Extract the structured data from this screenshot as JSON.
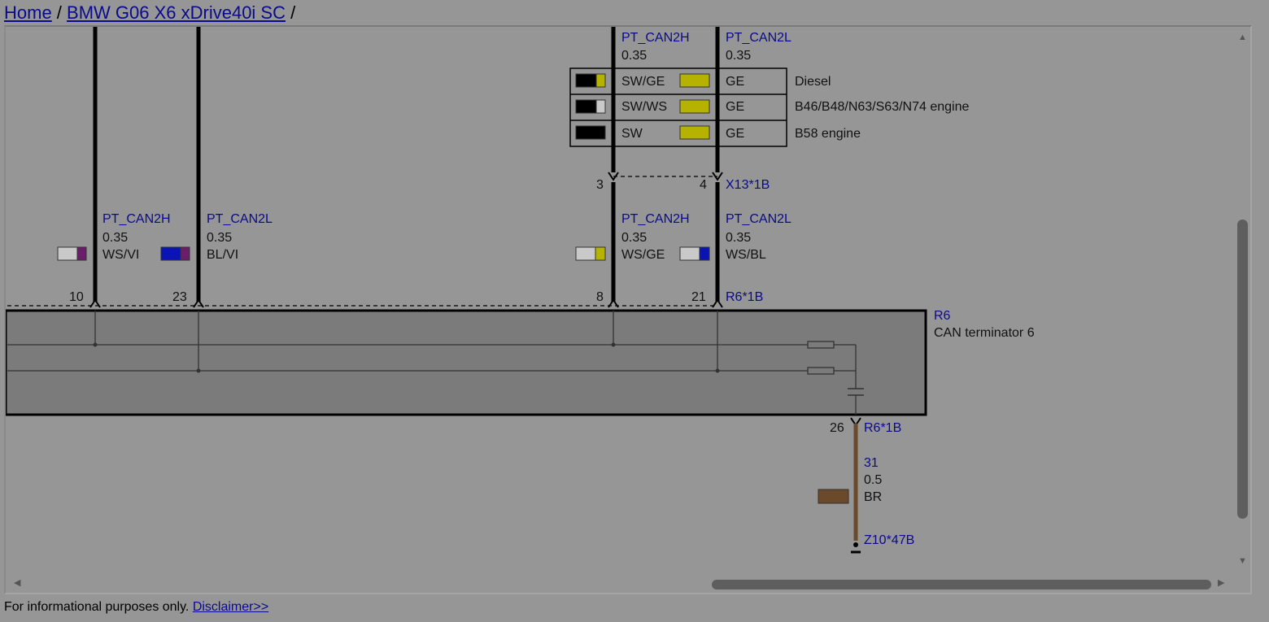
{
  "breadcrumb": {
    "home": "Home",
    "sep1": " / ",
    "vehicle": "BMW G06 X6 xDrive40i SC",
    "sep2": " /"
  },
  "footer": {
    "text": "For informational purposes only. ",
    "link": "Disclaimer>>"
  },
  "scroll": {
    "up_arrow": "▲",
    "down_arrow": "▼",
    "left_arrow": "◀",
    "right_arrow": "▶"
  },
  "wires": {
    "x13_h": {
      "signal": "PT_CAN2H",
      "gauge": "0.35"
    },
    "x13_l": {
      "signal": "PT_CAN2L",
      "gauge": "0.35"
    },
    "left_h": {
      "signal": "PT_CAN2H",
      "gauge": "0.35",
      "color": "WS/VI"
    },
    "left_l": {
      "signal": "PT_CAN2L",
      "gauge": "0.35",
      "color": "BL/VI"
    },
    "r6_h": {
      "signal": "PT_CAN2H",
      "gauge": "0.35",
      "color": "WS/GE"
    },
    "r6_l": {
      "signal": "PT_CAN2L",
      "gauge": "0.35",
      "color": "WS/BL"
    },
    "ground": {
      "signal": "31",
      "gauge": "0.5",
      "color": "BR"
    }
  },
  "variants": [
    {
      "h_color": "SW/GE",
      "l_color": "GE",
      "note": "Diesel"
    },
    {
      "h_color": "SW/WS",
      "l_color": "GE",
      "note": "B46/B48/N63/S63/N74 engine"
    },
    {
      "h_color": "SW",
      "l_color": "GE",
      "note": "B58 engine"
    }
  ],
  "connectors": {
    "x13": {
      "name": "X13*1B",
      "pin_h": "3",
      "pin_l": "4"
    },
    "r6_top": {
      "name": "R6*1B",
      "pins": [
        "10",
        "23",
        "8",
        "21"
      ]
    },
    "r6_bottom": {
      "name": "R6*1B",
      "pin": "26"
    },
    "ground_point": {
      "name": "Z10*47B"
    }
  },
  "component": {
    "id": "R6",
    "name": "CAN terminator 6"
  },
  "colors": {
    "link": "#0a0a8c",
    "background": "#969696",
    "component_fill": "#7b7b7b",
    "ground_wire": "#6b4a2b",
    "yellow": "#b5b300",
    "violet": "#6a1e6a",
    "blue": "#0a14b4"
  }
}
